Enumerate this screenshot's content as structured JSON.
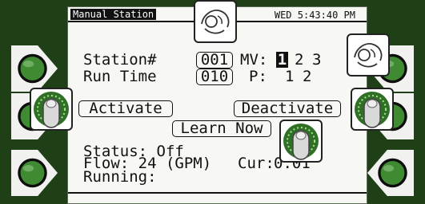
{
  "header": {
    "screen_title": "Manual Station",
    "datetime": "WED 5:43:40 PM"
  },
  "station": {
    "label": "Station#",
    "value": "001"
  },
  "run_time": {
    "label": "Run Time",
    "value": "010"
  },
  "master_valve": {
    "label": "MV:",
    "options": [
      "1",
      "2",
      "3"
    ],
    "selected": "1"
  },
  "pump": {
    "label": "P:",
    "options": [
      "1",
      "2"
    ]
  },
  "buttons": {
    "activate": "Activate",
    "deactivate": "Deactivate",
    "learn_now": "Learn Now"
  },
  "status": {
    "status_line": "Status: Off",
    "flow_line": "Flow: 24 (GPM)",
    "current_label": "Cur:",
    "current_value": "0.01",
    "running_label": "Running:"
  },
  "colors": {
    "bezel": "#1f3f17",
    "button_green": "#3f8a32",
    "screen_bg": "#f7f7f4",
    "text": "#111111"
  }
}
